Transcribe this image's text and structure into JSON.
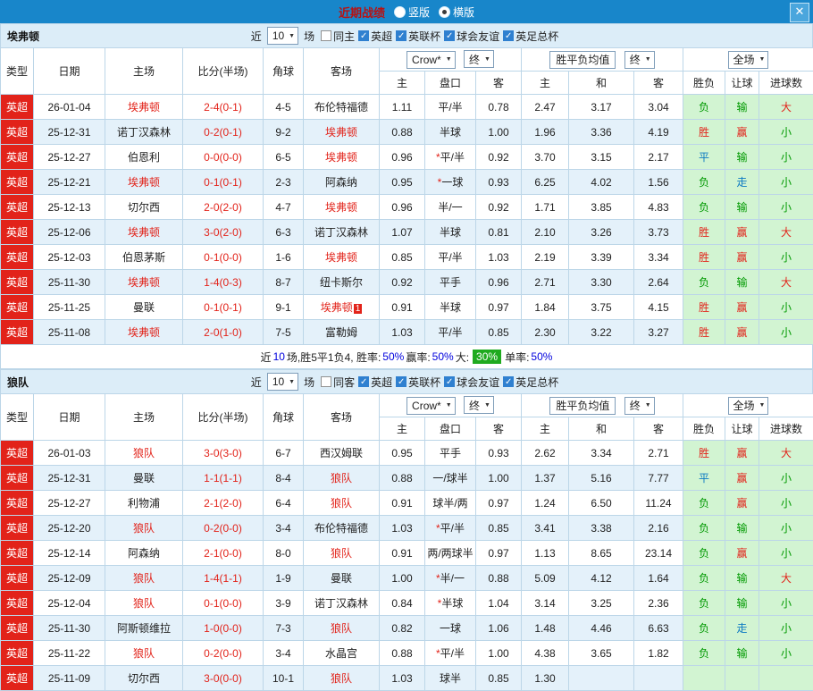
{
  "topbar": {
    "title": "近期战绩",
    "vertical": "竖版",
    "horizontal": "横版",
    "close": "✕"
  },
  "labels": {
    "near": "近",
    "games": "场"
  },
  "columns": [
    "类型",
    "日期",
    "主场",
    "比分(半场)",
    "角球",
    "客场",
    "主",
    "盘口",
    "客",
    "主",
    "和",
    "客",
    "胜负",
    "让球",
    "进球数"
  ],
  "sections": [
    {
      "team": "埃弗顿",
      "count": "10",
      "checkboxes": [
        {
          "label": "同主",
          "checked": false
        },
        {
          "label": "英超",
          "checked": true
        },
        {
          "label": "英联杯",
          "checked": true
        },
        {
          "label": "球会友谊",
          "checked": true
        },
        {
          "label": "英足总杯",
          "checked": true
        }
      ],
      "controls": {
        "company": "Crow*",
        "final1": "终",
        "avg": "胜平负均值",
        "final2": "终",
        "scope": "全场"
      },
      "rows": [
        {
          "league": "英超",
          "date": "26-01-04",
          "home": "埃弗顿",
          "home_red": true,
          "score": "2-4(0-1)",
          "corner": "4-5",
          "away": "布伦特福德",
          "away_red": false,
          "note": "",
          "ah_home": "1.11",
          "handicap": "平/半",
          "ah_away": "0.78",
          "eu_home": "2.47",
          "eu_draw": "3.17",
          "eu_away": "3.04",
          "result": "负",
          "bet": "输",
          "goals": "大"
        },
        {
          "league": "英超",
          "date": "25-12-31",
          "home": "诺丁汉森林",
          "home_red": false,
          "score": "0-2(0-1)",
          "corner": "9-2",
          "away": "埃弗顿",
          "away_red": true,
          "note": "",
          "ah_home": "0.88",
          "handicap": "半球",
          "ah_away": "1.00",
          "eu_home": "1.96",
          "eu_draw": "3.36",
          "eu_away": "4.19",
          "result": "胜",
          "bet": "赢",
          "goals": "小"
        },
        {
          "league": "英超",
          "date": "25-12-27",
          "home": "伯恩利",
          "home_red": false,
          "score": "0-0(0-0)",
          "corner": "6-5",
          "away": "埃弗顿",
          "away_red": true,
          "note": "",
          "ah_home": "0.96",
          "handicap": "*平/半",
          "ah_away": "0.92",
          "eu_home": "3.70",
          "eu_draw": "3.15",
          "eu_away": "2.17",
          "result": "平",
          "bet": "输",
          "goals": "小"
        },
        {
          "league": "英超",
          "date": "25-12-21",
          "home": "埃弗顿",
          "home_red": true,
          "score": "0-1(0-1)",
          "corner": "2-3",
          "away": "阿森纳",
          "away_red": false,
          "note": "",
          "ah_home": "0.95",
          "handicap": "*一球",
          "ah_away": "0.93",
          "eu_home": "6.25",
          "eu_draw": "4.02",
          "eu_away": "1.56",
          "result": "负",
          "bet": "走",
          "goals": "小"
        },
        {
          "league": "英超",
          "date": "25-12-13",
          "home": "切尔西",
          "home_red": false,
          "score": "2-0(2-0)",
          "corner": "4-7",
          "away": "埃弗顿",
          "away_red": true,
          "note": "",
          "ah_home": "0.96",
          "handicap": "半/一",
          "ah_away": "0.92",
          "eu_home": "1.71",
          "eu_draw": "3.85",
          "eu_away": "4.83",
          "result": "负",
          "bet": "输",
          "goals": "小"
        },
        {
          "league": "英超",
          "date": "25-12-06",
          "home": "埃弗顿",
          "home_red": true,
          "score": "3-0(2-0)",
          "corner": "6-3",
          "away": "诺丁汉森林",
          "away_red": false,
          "note": "",
          "ah_home": "1.07",
          "handicap": "半球",
          "ah_away": "0.81",
          "eu_home": "2.10",
          "eu_draw": "3.26",
          "eu_away": "3.73",
          "result": "胜",
          "bet": "赢",
          "goals": "大"
        },
        {
          "league": "英超",
          "date": "25-12-03",
          "home": "伯恩茅斯",
          "home_red": false,
          "score": "0-1(0-0)",
          "corner": "1-6",
          "away": "埃弗顿",
          "away_red": true,
          "note": "",
          "ah_home": "0.85",
          "handicap": "平/半",
          "ah_away": "1.03",
          "eu_home": "2.19",
          "eu_draw": "3.39",
          "eu_away": "3.34",
          "result": "胜",
          "bet": "赢",
          "goals": "小"
        },
        {
          "league": "英超",
          "date": "25-11-30",
          "home": "埃弗顿",
          "home_red": true,
          "score": "1-4(0-3)",
          "corner": "8-7",
          "away": "纽卡斯尔",
          "away_red": false,
          "note": "",
          "ah_home": "0.92",
          "handicap": "平手",
          "ah_away": "0.96",
          "eu_home": "2.71",
          "eu_draw": "3.30",
          "eu_away": "2.64",
          "result": "负",
          "bet": "输",
          "goals": "大"
        },
        {
          "league": "英超",
          "date": "25-11-25",
          "home": "曼联",
          "home_red": false,
          "score": "0-1(0-1)",
          "corner": "9-1",
          "away": "埃弗顿",
          "away_red": true,
          "note": "1",
          "ah_home": "0.91",
          "handicap": "半球",
          "ah_away": "0.97",
          "eu_home": "1.84",
          "eu_draw": "3.75",
          "eu_away": "4.15",
          "result": "胜",
          "bet": "赢",
          "goals": "小"
        },
        {
          "league": "英超",
          "date": "25-11-08",
          "home": "埃弗顿",
          "home_red": true,
          "score": "2-0(1-0)",
          "corner": "7-5",
          "away": "富勒姆",
          "away_red": false,
          "note": "",
          "ah_home": "1.03",
          "handicap": "平/半",
          "ah_away": "0.85",
          "eu_home": "2.30",
          "eu_draw": "3.22",
          "eu_away": "3.27",
          "result": "胜",
          "bet": "赢",
          "goals": "小"
        }
      ],
      "summary": [
        {
          "text": "近",
          "style": "plain"
        },
        {
          "text": "10",
          "style": "blue"
        },
        {
          "text": "场,胜5平1负4, 胜率:",
          "style": "plain"
        },
        {
          "text": "50%",
          "style": "blue"
        },
        {
          "text": " 赢率:",
          "style": "plain"
        },
        {
          "text": "50%",
          "style": "blue"
        },
        {
          "text": " 大:",
          "style": "plain"
        },
        {
          "text": "30%",
          "style": "badge"
        },
        {
          "text": " 单率:",
          "style": "plain"
        },
        {
          "text": "50%",
          "style": "blue"
        }
      ]
    },
    {
      "team": "狼队",
      "count": "10",
      "checkboxes": [
        {
          "label": "同客",
          "checked": false
        },
        {
          "label": "英超",
          "checked": true
        },
        {
          "label": "英联杯",
          "checked": true
        },
        {
          "label": "球会友谊",
          "checked": true
        },
        {
          "label": "英足总杯",
          "checked": true
        }
      ],
      "controls": {
        "company": "Crow*",
        "final1": "终",
        "avg": "胜平负均值",
        "final2": "终",
        "scope": "全场"
      },
      "rows": [
        {
          "league": "英超",
          "date": "26-01-03",
          "home": "狼队",
          "home_red": true,
          "score": "3-0(3-0)",
          "corner": "6-7",
          "away": "西汉姆联",
          "away_red": false,
          "note": "",
          "ah_home": "0.95",
          "handicap": "平手",
          "ah_away": "0.93",
          "eu_home": "2.62",
          "eu_draw": "3.34",
          "eu_away": "2.71",
          "result": "胜",
          "bet": "赢",
          "goals": "大"
        },
        {
          "league": "英超",
          "date": "25-12-31",
          "home": "曼联",
          "home_red": false,
          "score": "1-1(1-1)",
          "corner": "8-4",
          "away": "狼队",
          "away_red": true,
          "note": "",
          "ah_home": "0.88",
          "handicap": "一/球半",
          "ah_away": "1.00",
          "eu_home": "1.37",
          "eu_draw": "5.16",
          "eu_away": "7.77",
          "result": "平",
          "bet": "赢",
          "goals": "小"
        },
        {
          "league": "英超",
          "date": "25-12-27",
          "home": "利物浦",
          "home_red": false,
          "score": "2-1(2-0)",
          "corner": "6-4",
          "away": "狼队",
          "away_red": true,
          "note": "",
          "ah_home": "0.91",
          "handicap": "球半/两",
          "ah_away": "0.97",
          "eu_home": "1.24",
          "eu_draw": "6.50",
          "eu_away": "11.24",
          "result": "负",
          "bet": "赢",
          "goals": "小"
        },
        {
          "league": "英超",
          "date": "25-12-20",
          "home": "狼队",
          "home_red": true,
          "score": "0-2(0-0)",
          "corner": "3-4",
          "away": "布伦特福德",
          "away_red": false,
          "note": "",
          "ah_home": "1.03",
          "handicap": "*平/半",
          "ah_away": "0.85",
          "eu_home": "3.41",
          "eu_draw": "3.38",
          "eu_away": "2.16",
          "result": "负",
          "bet": "输",
          "goals": "小"
        },
        {
          "league": "英超",
          "date": "25-12-14",
          "home": "阿森纳",
          "home_red": false,
          "score": "2-1(0-0)",
          "corner": "8-0",
          "away": "狼队",
          "away_red": true,
          "note": "",
          "ah_home": "0.91",
          "handicap": "两/两球半",
          "ah_away": "0.97",
          "eu_home": "1.13",
          "eu_draw": "8.65",
          "eu_away": "23.14",
          "result": "负",
          "bet": "赢",
          "goals": "小"
        },
        {
          "league": "英超",
          "date": "25-12-09",
          "home": "狼队",
          "home_red": true,
          "score": "1-4(1-1)",
          "corner": "1-9",
          "away": "曼联",
          "away_red": false,
          "note": "",
          "ah_home": "1.00",
          "handicap": "*半/一",
          "ah_away": "0.88",
          "eu_home": "5.09",
          "eu_draw": "4.12",
          "eu_away": "1.64",
          "result": "负",
          "bet": "输",
          "goals": "大"
        },
        {
          "league": "英超",
          "date": "25-12-04",
          "home": "狼队",
          "home_red": true,
          "score": "0-1(0-0)",
          "corner": "3-9",
          "away": "诺丁汉森林",
          "away_red": false,
          "note": "",
          "ah_home": "0.84",
          "handicap": "*半球",
          "ah_away": "1.04",
          "eu_home": "3.14",
          "eu_draw": "3.25",
          "eu_away": "2.36",
          "result": "负",
          "bet": "输",
          "goals": "小"
        },
        {
          "league": "英超",
          "date": "25-11-30",
          "home": "阿斯顿维拉",
          "home_red": false,
          "score": "1-0(0-0)",
          "corner": "7-3",
          "away": "狼队",
          "away_red": true,
          "note": "",
          "ah_home": "0.82",
          "handicap": "一球",
          "ah_away": "1.06",
          "eu_home": "1.48",
          "eu_draw": "4.46",
          "eu_away": "6.63",
          "result": "负",
          "bet": "走",
          "goals": "小"
        },
        {
          "league": "英超",
          "date": "25-11-22",
          "home": "狼队",
          "home_red": true,
          "score": "0-2(0-0)",
          "corner": "3-4",
          "away": "水晶宫",
          "away_red": false,
          "note": "",
          "ah_home": "0.88",
          "handicap": "*平/半",
          "ah_away": "1.00",
          "eu_home": "4.38",
          "eu_draw": "3.65",
          "eu_away": "1.82",
          "result": "负",
          "bet": "输",
          "goals": "小"
        },
        {
          "league": "英超",
          "date": "25-11-09",
          "home": "切尔西",
          "home_red": false,
          "score": "3-0(0-0)",
          "corner": "10-1",
          "away": "狼队",
          "away_red": true,
          "note": "",
          "ah_home": "1.03",
          "handicap": "球半",
          "ah_away": "0.85",
          "eu_home": "1.30",
          "eu_draw": "",
          "eu_away": "",
          "result": "",
          "bet": "",
          "goals": ""
        }
      ],
      "summary": []
    }
  ]
}
